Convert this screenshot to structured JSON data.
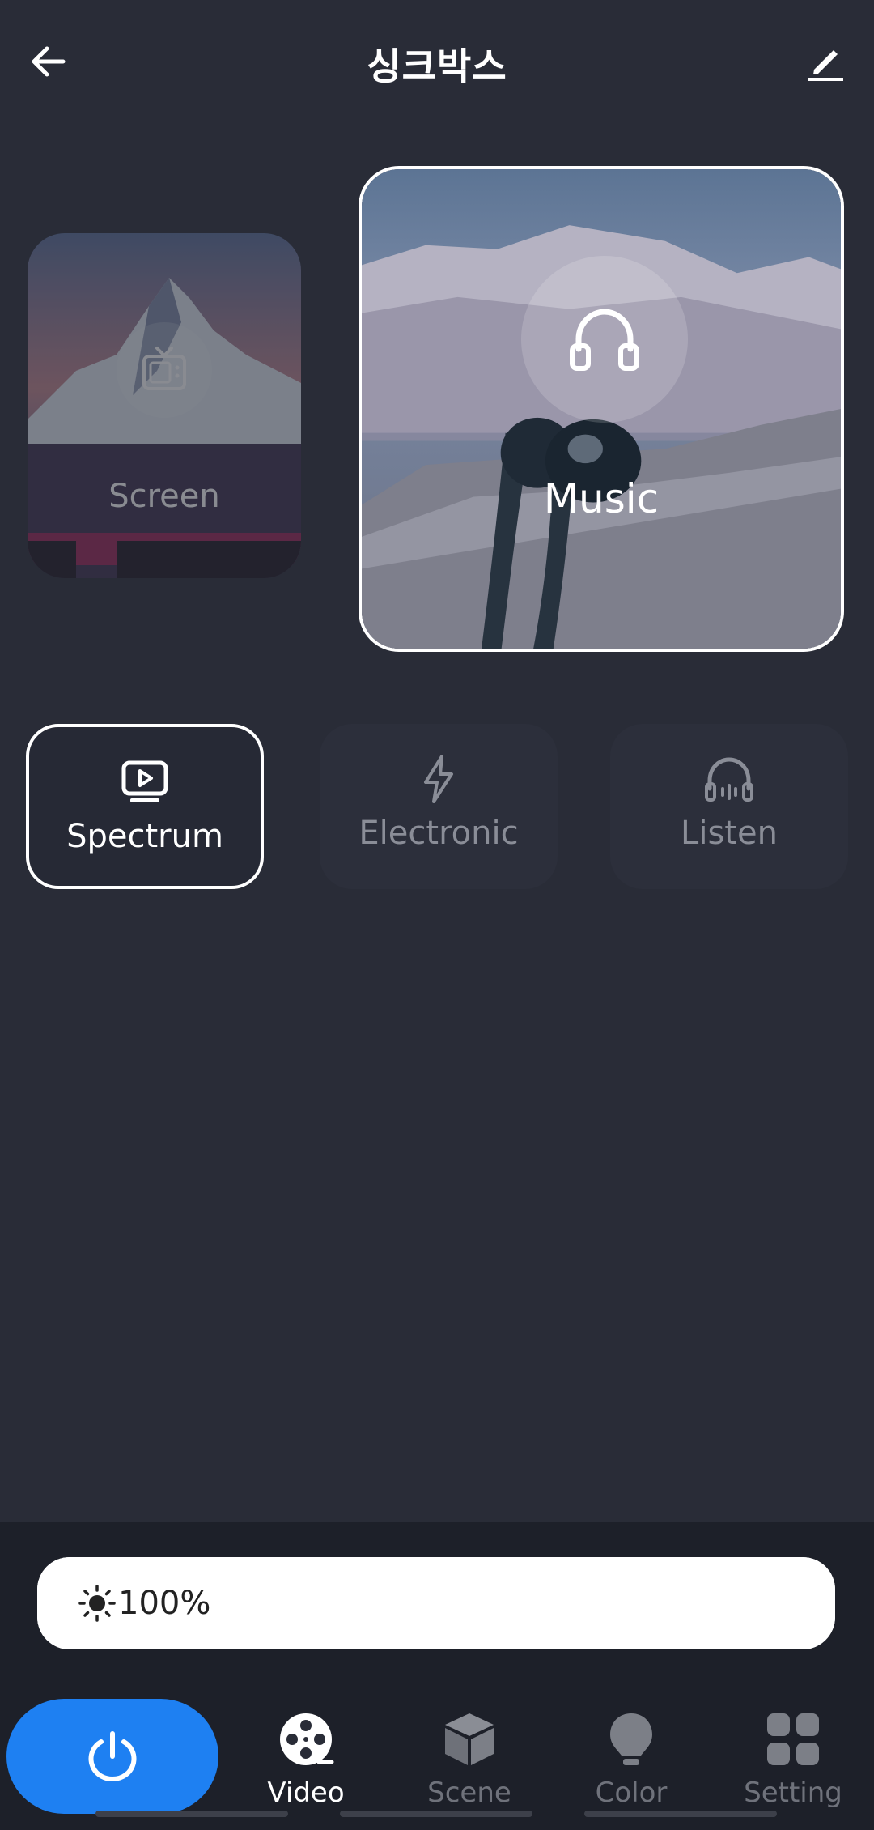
{
  "header": {
    "title": "싱크박스",
    "back_icon": "arrow-left-icon",
    "edit_icon": "pencil-icon"
  },
  "cards": [
    {
      "label": "Screen",
      "icon": "tv-icon",
      "selected": false
    },
    {
      "label": "Music",
      "icon": "headphones-icon",
      "selected": true
    }
  ],
  "modes": [
    {
      "label": "Spectrum",
      "icon": "monitor-play-icon",
      "selected": true
    },
    {
      "label": "Electronic",
      "icon": "lightning-icon",
      "selected": false
    },
    {
      "label": "Listen",
      "icon": "headphones-wave-icon",
      "selected": false
    }
  ],
  "brightness": {
    "value_text": "100%",
    "level": 1.0,
    "icon": "sun-icon"
  },
  "nav": {
    "power_icon": "power-icon",
    "items": [
      {
        "label": "Video",
        "icon": "film-reel-icon",
        "active": true
      },
      {
        "label": "Scene",
        "icon": "cube-icon",
        "active": false
      },
      {
        "label": "Color",
        "icon": "bulb-icon",
        "active": false
      },
      {
        "label": "Setting",
        "icon": "grid-icon",
        "active": false
      }
    ]
  },
  "colors": {
    "background": "#292c37",
    "accent": "#1e80f2",
    "panel": "#1d2029"
  }
}
